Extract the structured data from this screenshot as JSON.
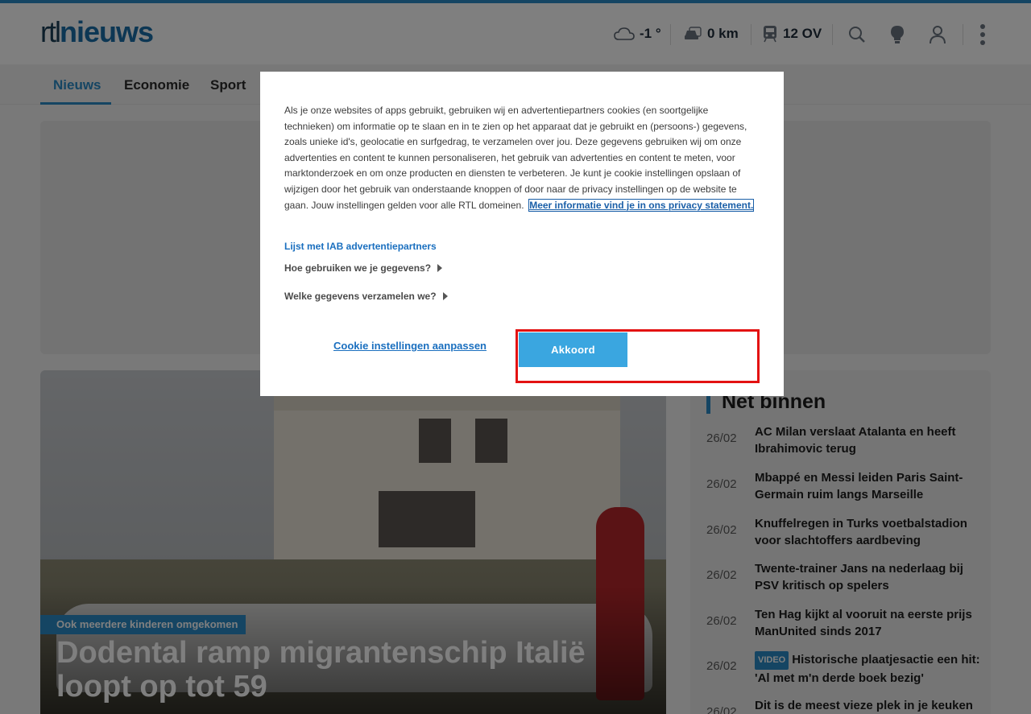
{
  "header": {
    "logo_part1": "rtl",
    "logo_part2": "nieuws",
    "weather": "-1 °",
    "traffic": "0 km",
    "transit": "12 OV"
  },
  "nav": {
    "items": [
      "Nieuws",
      "Economie",
      "Sport"
    ]
  },
  "hero": {
    "tag": "Ook meerdere kinderen omgekomen",
    "title": "Dodental ramp migrantenschip Italië loopt op tot 59"
  },
  "sidebar": {
    "title": "Net binnen",
    "items": [
      {
        "date": "26/02",
        "text": "AC Milan verslaat Atalanta en heeft Ibrahimovic terug"
      },
      {
        "date": "26/02",
        "text": "Mbappé en Messi leiden Paris Saint-Germain ruim langs Marseille"
      },
      {
        "date": "26/02",
        "text": "Knuffelregen in Turks voetbalstadion voor slachtoffers aardbeving"
      },
      {
        "date": "26/02",
        "text": "Twente-trainer Jans na nederlaag bij PSV kritisch op spelers"
      },
      {
        "date": "26/02",
        "text": "Ten Hag kijkt al vooruit na eerste prijs ManUnited sinds 2017"
      },
      {
        "date": "26/02",
        "badge": "VIDEO",
        "text": "Historische plaatjesactie een hit: 'Al met m'n derde boek bezig'"
      },
      {
        "date": "26/02",
        "text": "Dit is de meest vieze plek in je keuken"
      }
    ]
  },
  "cookie_modal": {
    "body": "Als je onze websites of apps gebruikt, gebruiken wij en advertentiepartners cookies (en soortgelijke technieken) om informatie op te slaan en in te zien op het apparaat dat je gebruikt en (persoons-) gegevens, zoals unieke id's, geolocatie en surfgedrag, te verzamelen over jou. Deze gegevens gebruiken wij om onze advertenties en content te kunnen personaliseren, het gebruik van advertenties en content te meten, voor marktonderzoek en om onze producten en diensten te verbeteren. Je kunt je cookie instellingen opslaan of wijzigen door het gebruik van onderstaande knoppen of door naar de privacy instellingen op de website te gaan. Jouw instellingen gelden voor alle RTL domeinen.",
    "privacy_link": "Meer informatie vind je in ons privacy statement.",
    "iab_link": "Lijst met IAB advertentiepartners",
    "expander1": "Hoe gebruiken we je gegevens?",
    "expander2": "Welke gegevens verzamelen we?",
    "settings_link": "Cookie instellingen aanpassen",
    "accept_label": "Akkoord"
  },
  "colors": {
    "accent": "#2b8bc6",
    "accept_button": "#3aa6e0",
    "highlight": "#e31212"
  }
}
